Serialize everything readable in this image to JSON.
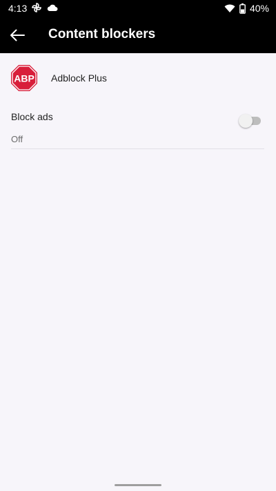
{
  "status_bar": {
    "time": "4:13",
    "battery": "40%",
    "icons": [
      "pinwheel-icon",
      "cloud-icon",
      "wifi-icon",
      "battery-icon"
    ]
  },
  "app_bar": {
    "title": "Content blockers",
    "back_icon": "arrow-left-icon"
  },
  "provider": {
    "name": "Adblock Plus",
    "logo_text": "ABP",
    "logo_color": "#d81e3a"
  },
  "setting": {
    "title": "Block ads",
    "summary": "Off",
    "enabled": false
  },
  "colors": {
    "bar_background": "#000000",
    "page_background": "#f7f5fa"
  }
}
